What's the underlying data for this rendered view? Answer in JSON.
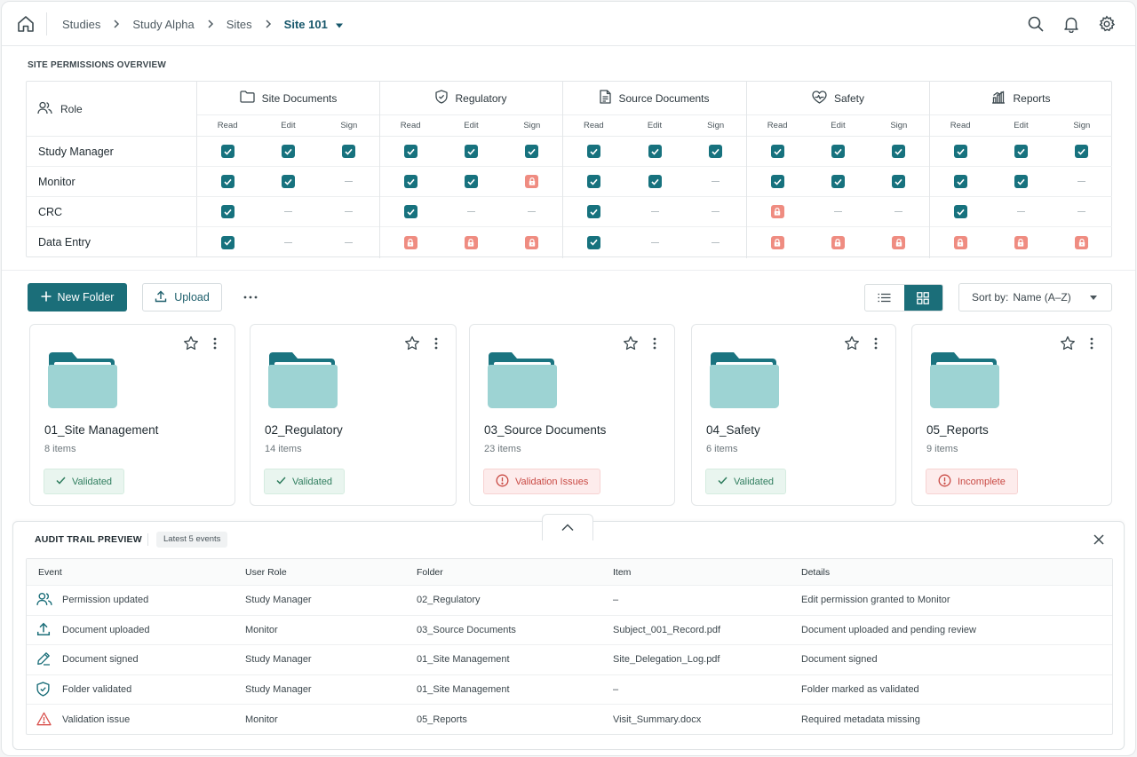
{
  "breadcrumb": {
    "items": [
      "Studies",
      "Study Alpha",
      "Sites"
    ],
    "current": "Site 101"
  },
  "icons": {
    "home": "home-icon",
    "search": "search-icon",
    "notifications": "bell-icon",
    "settings": "gear-icon"
  },
  "permissions": {
    "title": "SITE PERMISSIONS OVERVIEW",
    "role_header": "Role",
    "groups": [
      {
        "label": "Site Documents",
        "icon": "folder-icon"
      },
      {
        "label": "Regulatory",
        "icon": "shield-icon"
      },
      {
        "label": "Source Documents",
        "icon": "document-icon"
      },
      {
        "label": "Safety",
        "icon": "heart-pulse-icon"
      },
      {
        "label": "Reports",
        "icon": "bar-chart-icon"
      }
    ],
    "columns": [
      "Read",
      "Edit",
      "Sign"
    ],
    "roles": [
      {
        "name": "Study Manager",
        "cells": [
          "check",
          "check",
          "check",
          "check",
          "check",
          "check",
          "check",
          "check",
          "check",
          "check",
          "check",
          "check",
          "check",
          "check",
          "check"
        ]
      },
      {
        "name": "Monitor",
        "cells": [
          "check",
          "check",
          "none",
          "check",
          "check",
          "lock",
          "check",
          "check",
          "none",
          "check",
          "check",
          "check",
          "check",
          "check",
          "none"
        ]
      },
      {
        "name": "CRC",
        "cells": [
          "check",
          "none",
          "none",
          "check",
          "none",
          "none",
          "check",
          "none",
          "none",
          "lock",
          "none",
          "none",
          "check",
          "none",
          "none"
        ]
      },
      {
        "name": "Data Entry",
        "cells": [
          "check",
          "none",
          "none",
          "lock",
          "lock",
          "lock",
          "check",
          "none",
          "none",
          "lock",
          "lock",
          "lock",
          "lock",
          "lock",
          "lock"
        ]
      }
    ]
  },
  "toolbar": {
    "new_folder": "New Folder",
    "upload": "Upload",
    "sort_label": "Sort by:",
    "sort_value": "Name (A–Z)"
  },
  "folders": [
    {
      "name": "01_Site Management",
      "count": "8 items",
      "status": "Validated",
      "status_type": "ok"
    },
    {
      "name": "02_Regulatory",
      "count": "14 items",
      "status": "Validated",
      "status_type": "ok"
    },
    {
      "name": "03_Source Documents",
      "count": "23 items",
      "status": "Validation Issues",
      "status_type": "err"
    },
    {
      "name": "04_Safety",
      "count": "6 items",
      "status": "Validated",
      "status_type": "ok"
    },
    {
      "name": "05_Reports",
      "count": "9 items",
      "status": "Incomplete",
      "status_type": "err"
    }
  ],
  "audit": {
    "title": "AUDIT TRAIL PREVIEW",
    "pill": "Latest 5 events",
    "columns": [
      "Event",
      "User Role",
      "Folder",
      "Item",
      "Details"
    ],
    "rows": [
      {
        "icon": "users-icon",
        "event": "Permission updated",
        "role": "Study Manager",
        "folder": "02_Regulatory",
        "item": "–",
        "details": "Edit permission granted to Monitor"
      },
      {
        "icon": "upload-icon",
        "event": "Document uploaded",
        "role": "Monitor",
        "folder": "03_Source Documents",
        "item": "Subject_001_Record.pdf",
        "details": "Document uploaded and pending review"
      },
      {
        "icon": "pen-icon",
        "event": "Document signed",
        "role": "Study Manager",
        "folder": "01_Site Management",
        "item": "Site_Delegation_Log.pdf",
        "details": "Document signed"
      },
      {
        "icon": "shield-check-icon",
        "event": "Folder validated",
        "role": "Study Manager",
        "folder": "01_Site Management",
        "item": "–",
        "details": "Folder marked as validated"
      },
      {
        "icon": "warning-icon",
        "event": "Validation issue",
        "role": "Monitor",
        "folder": "05_Reports",
        "item": "Visit_Summary.docx",
        "details": "Required metadata missing"
      }
    ]
  },
  "colors": {
    "primary": "#1b6e79",
    "check": "#17727e",
    "lock": "#ef8c81",
    "folder_tab": "#1b7480",
    "folder_body": "#9dd3d3",
    "ok": "#2f7d5e",
    "error": "#c94a44"
  }
}
